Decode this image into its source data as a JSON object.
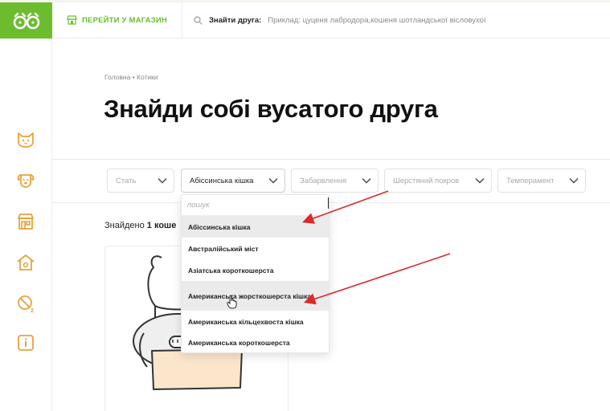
{
  "colors": {
    "brand": "#6bbd2e",
    "arrow": "#d92b2b",
    "text": "#222222",
    "muted": "#8a8a8a"
  },
  "header": {
    "shop_label": "ПЕРЕЙТИ У МАГАЗИН",
    "search_label": "Знайти друга:",
    "search_placeholder": "Приклад: цуценя лабродора,кошеня шотландської вісловухої"
  },
  "sidebar": {
    "icons": [
      "cat-icon",
      "dog-icon",
      "shop-icon",
      "shelter-icon",
      "no-parasites-icon",
      "info-icon"
    ]
  },
  "breadcrumb": {
    "home": "Головна",
    "separator": "•",
    "current": "Котики"
  },
  "page_title": "Знайди собі вусатого друга",
  "filters": [
    {
      "label": "Стать",
      "active": false
    },
    {
      "label": "Абіссинська кішка",
      "active": true
    },
    {
      "label": "Забарвлення",
      "active": false
    },
    {
      "label": "Шерстяний покров",
      "active": false
    },
    {
      "label": "Темперамент",
      "active": false
    }
  ],
  "results": {
    "prefix": "Знайдено",
    "count_text": "1 коше"
  },
  "dropdown": {
    "search_placeholder": "пошук",
    "options": [
      {
        "label": "Абіссинська кішка",
        "highlighted": true
      },
      {
        "label": "Австралійський міст",
        "highlighted": false
      },
      {
        "label": "Азіатська короткошерста",
        "highlighted": false
      },
      {
        "label": "Американська жорсткошерста кішка",
        "highlighted": true
      },
      {
        "label": "Американська кільцехвоста кішка",
        "highlighted": false
      },
      {
        "label": "Американська короткошерста",
        "highlighted": false
      }
    ]
  }
}
